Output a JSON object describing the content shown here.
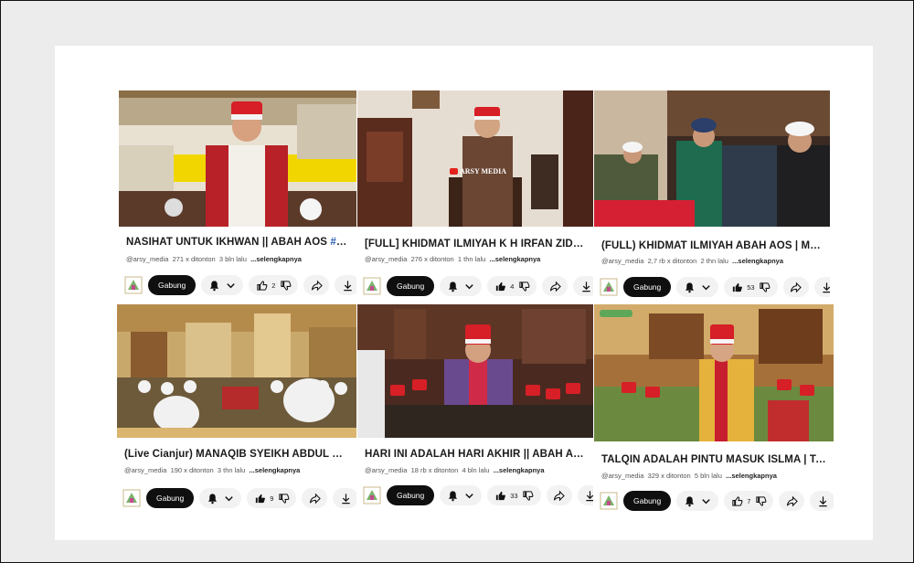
{
  "cards": [
    {
      "title": "NASIHAT UNTUK IKHWAN || ABAH AOS ",
      "title_tag": "#ab…",
      "channel": "@arsy_media",
      "views": "271 x ditonton",
      "age": "3 bln lalu",
      "more": "...selengkapnya",
      "join": "Gabung",
      "likes": "2",
      "like_filled": false
    },
    {
      "title": "[FULL] KHIDMAT ILMIYAH K H  IRFAN ZIDNY…",
      "title_tag": "",
      "channel": "@arsy_media",
      "views": "276 x ditonton",
      "age": "1 thn lalu",
      "more": "...selengkapnya",
      "join": "Gabung",
      "likes": "4",
      "like_filled": true,
      "watermark": "ARSY MEDIA"
    },
    {
      "title": "(FULL) KHIDMAT ILMIYAH ABAH AOS | MAN…",
      "title_tag": "",
      "channel": "@arsy_media",
      "views": "2,7 rb x ditonton",
      "age": "2 thn lalu",
      "more": "...selengkapnya",
      "join": "Gabung",
      "likes": "53",
      "like_filled": true
    },
    {
      "title": "(Live Cianjur) MANAQIB SYEIKH ABDUL QO…",
      "title_tag": "",
      "channel": "@arsy_media",
      "views": "190 x ditonton",
      "age": "3 thn lalu",
      "more": "...selengkapnya",
      "join": "Gabung",
      "likes": "9",
      "like_filled": true
    },
    {
      "title": "HARI INI ADALAH HARI AKHIR || ABAH AOS…",
      "title_tag": "",
      "channel": "@arsy_media",
      "views": "18 rb x ditonton",
      "age": "4 bln lalu",
      "more": "...selengkapnya",
      "join": "Gabung",
      "likes": "33",
      "like_filled": true
    },
    {
      "title": "TALQIN ADALAH PINTU MASUK ISLMA | TA…",
      "title_tag": "",
      "channel": "@arsy_media",
      "views": "329 x ditonton",
      "age": "5 bln lalu",
      "more": "...selengkapnya",
      "join": "Gabung",
      "likes": "7",
      "like_filled": false
    }
  ],
  "icons": {
    "avatar": "channel-avatar-icon",
    "bell": "bell-icon",
    "chevron": "chevron-down-icon",
    "like": "thumbs-up-icon",
    "dislike": "thumbs-down-icon",
    "share": "share-icon",
    "download": "download-icon"
  },
  "colors": {
    "join_bg": "#0f0f0f",
    "hashtag": "#2a5db0",
    "red_cap": "#d61f26"
  }
}
